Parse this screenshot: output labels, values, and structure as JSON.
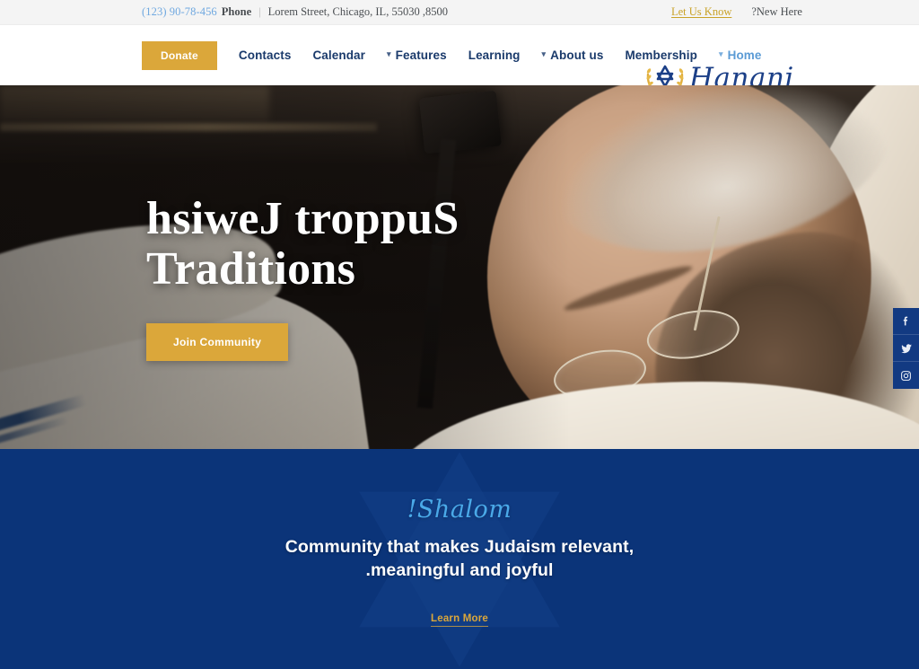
{
  "topbar": {
    "phone_number": "(123) 90-78-456",
    "phone_label": "Phone",
    "separator": "|",
    "address": "Lorem Street, Chicago, IL, 55030 ,8500",
    "new_here": "?New Here",
    "let_us_know": "Let Us Know"
  },
  "header": {
    "donate_label": "Donate",
    "logo_text": "Hanani",
    "nav": [
      {
        "label": "Contacts",
        "has_chevron": false,
        "active": false
      },
      {
        "label": "Calendar",
        "has_chevron": false,
        "active": false
      },
      {
        "label": "Features",
        "has_chevron": true,
        "active": false
      },
      {
        "label": "Learning",
        "has_chevron": false,
        "active": false
      },
      {
        "label": "About us",
        "has_chevron": true,
        "active": false
      },
      {
        "label": "Membership",
        "has_chevron": false,
        "active": false
      },
      {
        "label": "Home",
        "has_chevron": true,
        "active": true
      }
    ]
  },
  "hero": {
    "title_line1": "hsiweJ troppuS",
    "title_line2": "Traditions",
    "cta_label": "Join Community",
    "slides": [
      {
        "active": true
      },
      {
        "active": false
      },
      {
        "active": false
      }
    ],
    "social": [
      {
        "name": "facebook",
        "glyph": "f"
      },
      {
        "name": "twitter",
        "glyph": "ᴠ"
      },
      {
        "name": "instagram",
        "glyph": "◎"
      }
    ]
  },
  "welcome": {
    "greeting": "!Shalom",
    "headline_line1": "Community that makes Judaism relevant,",
    "headline_line2": ".meaningful and joyful",
    "link_label": "Learn More"
  },
  "colors": {
    "gold": "#dba73a",
    "navy": "#0b3479",
    "navy_dark": "#123a82",
    "light_blue": "#5b9bd5",
    "shalom_blue": "#4aa9e8",
    "topbar_bg": "#f4f4f4"
  }
}
